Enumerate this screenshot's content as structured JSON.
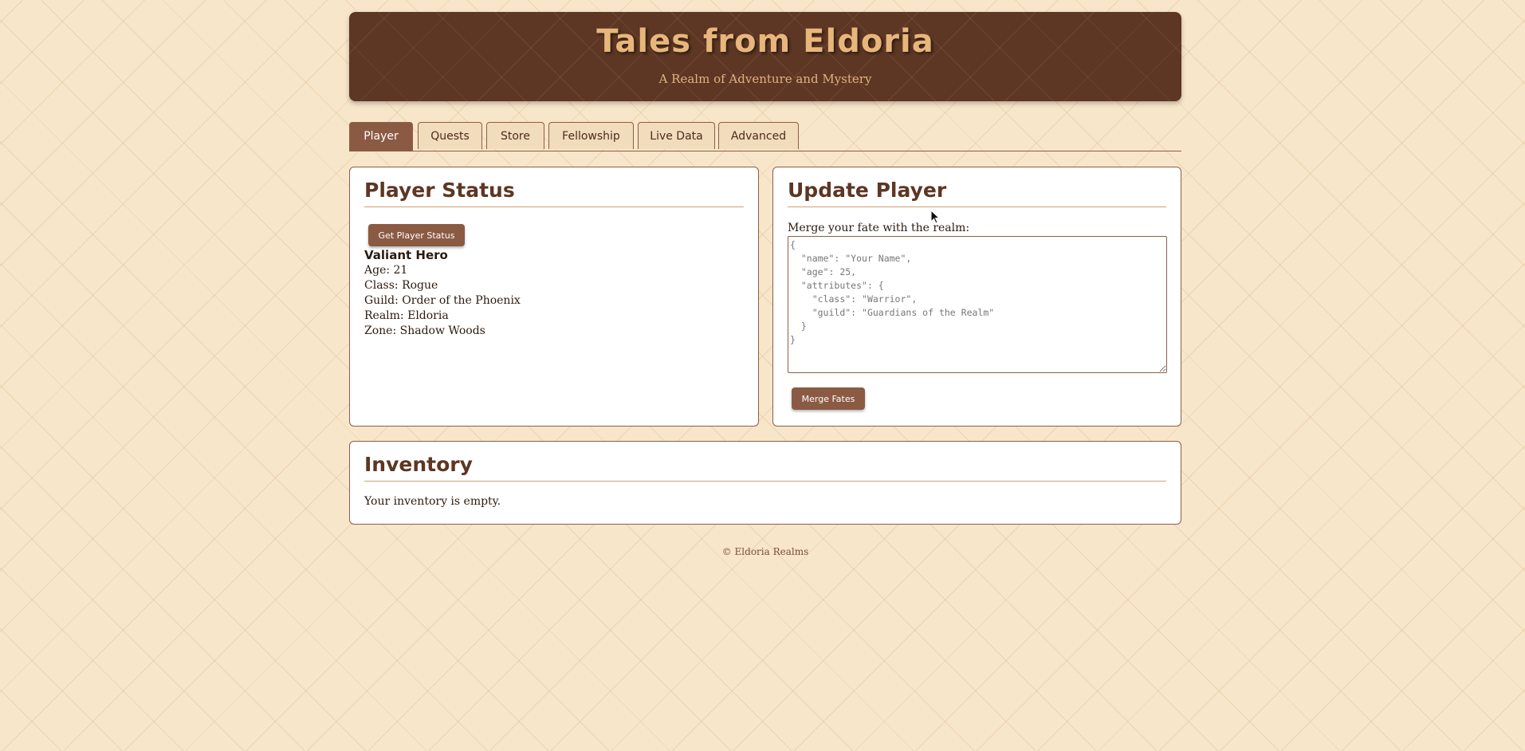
{
  "header": {
    "title": "Tales from Eldoria",
    "subtitle": "A Realm of Adventure and Mystery"
  },
  "tabs": [
    {
      "label": "Player",
      "active": true
    },
    {
      "label": "Quests",
      "active": false
    },
    {
      "label": "Store",
      "active": false
    },
    {
      "label": "Fellowship",
      "active": false
    },
    {
      "label": "Live Data",
      "active": false
    },
    {
      "label": "Advanced",
      "active": false
    }
  ],
  "player_status": {
    "heading": "Player Status",
    "button_label": "Get Player Status",
    "name": "Valiant Hero",
    "age": "Age: 21",
    "class": "Class: Rogue",
    "guild": "Guild: Order of the Phoenix",
    "realm": "Realm: Eldoria",
    "zone": "Zone: Shadow Woods"
  },
  "update_player": {
    "heading": "Update Player",
    "label": "Merge your fate with the realm:",
    "placeholder": "{\n  \"name\": \"Your Name\",\n  \"age\": 25,\n  \"attributes\": {\n    \"class\": \"Warrior\",\n    \"guild\": \"Guardians of the Realm\"\n  }\n}",
    "button_label": "Merge Fates"
  },
  "inventory": {
    "heading": "Inventory",
    "empty_text": "Your inventory is empty."
  },
  "footer": {
    "text": "© Eldoria Realms"
  },
  "colors": {
    "accent": "#8b5a43",
    "header_bg": "#5d3624",
    "title": "#e8b67b",
    "page_bg": "#f7e6ca"
  }
}
